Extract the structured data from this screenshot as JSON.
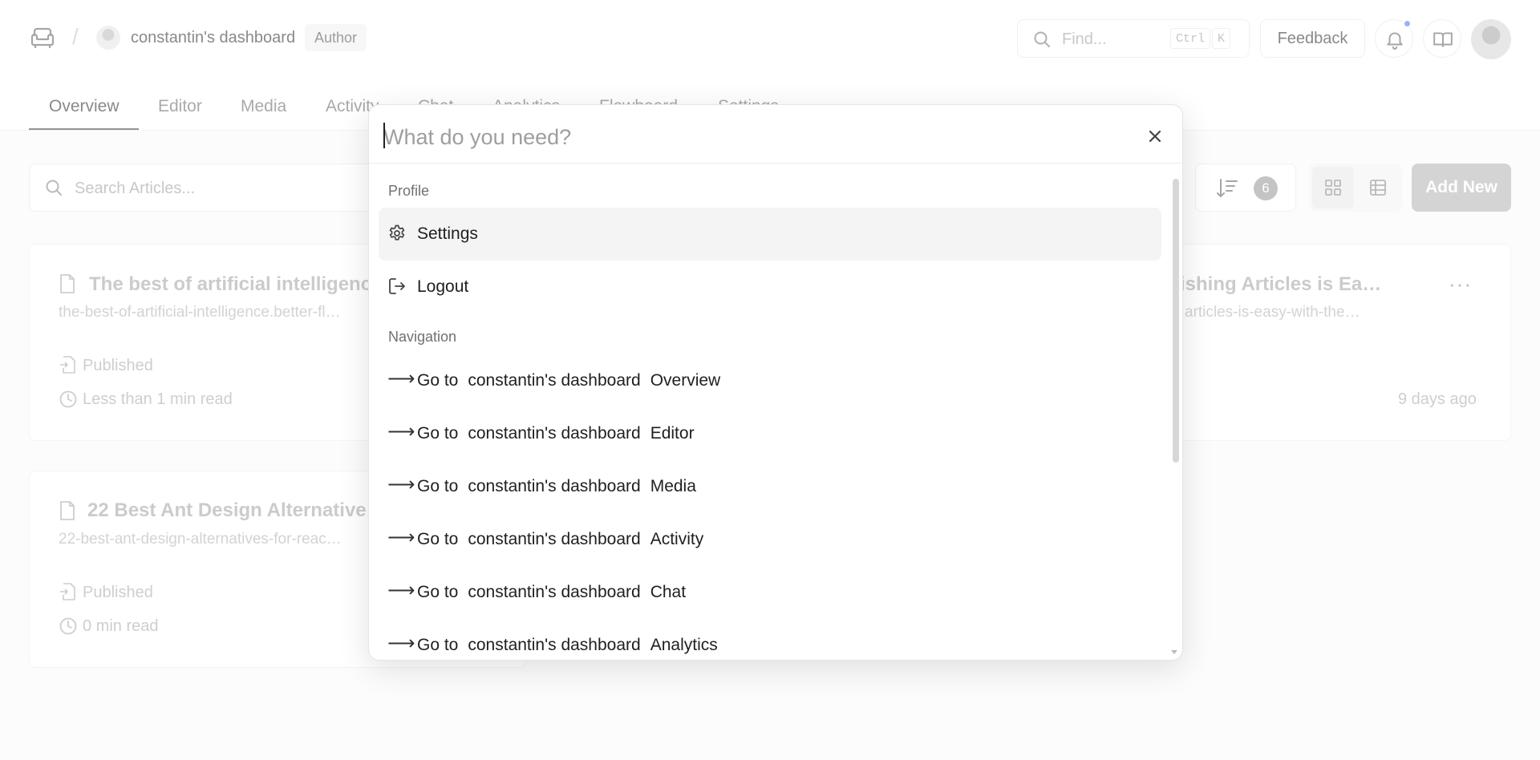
{
  "header": {
    "workspace_name": "constantin's dashboard",
    "role_badge": "Author",
    "find_placeholder": "Find...",
    "shortcut_ctrl": "Ctrl",
    "shortcut_key": "K",
    "feedback_label": "Feedback",
    "has_notification": true,
    "notification_color": "#4f7df2"
  },
  "tabs": [
    {
      "label": "Overview",
      "active": true
    },
    {
      "label": "Editor"
    },
    {
      "label": "Media"
    },
    {
      "label": "Activity"
    },
    {
      "label": "Chat"
    },
    {
      "label": "Analytics"
    },
    {
      "label": "Flowboard"
    },
    {
      "label": "Settings"
    }
  ],
  "toolbar": {
    "search_placeholder": "Search Articles...",
    "sort_count": "6",
    "add_new_label": "Add New"
  },
  "articles": [
    {
      "title": "The best of artificial intelligenc",
      "slug": "the-best-of-artificial-intelligence.better-fl…",
      "status": "Published",
      "read_time": "Less than 1 min read"
    },
    {
      "title": "22 Best Ant Design Alternative",
      "slug": "22-best-ant-design-alternatives-for-reac…",
      "status": "Published",
      "read_time": "0 min read"
    },
    {
      "title": "ishing Articles is Ea…",
      "slug": "articles-is-easy-with-the…",
      "age": "9 days ago",
      "more": "···"
    }
  ],
  "palette": {
    "placeholder": "What do you need?",
    "sections": [
      {
        "label": "Profile",
        "items": [
          {
            "label": "Settings",
            "icon": "gear-icon",
            "selected": true
          },
          {
            "label": "Logout",
            "icon": "logout-icon"
          }
        ]
      },
      {
        "label": "Navigation",
        "items": [
          {
            "prefix": "Go to",
            "workspace": "constantin's dashboard",
            "target": "Overview"
          },
          {
            "prefix": "Go to",
            "workspace": "constantin's dashboard",
            "target": "Editor"
          },
          {
            "prefix": "Go to",
            "workspace": "constantin's dashboard",
            "target": "Media"
          },
          {
            "prefix": "Go to",
            "workspace": "constantin's dashboard",
            "target": "Activity"
          },
          {
            "prefix": "Go to",
            "workspace": "constantin's dashboard",
            "target": "Chat"
          },
          {
            "prefix": "Go to",
            "workspace": "constantin's dashboard",
            "target": "Analytics"
          }
        ]
      }
    ],
    "arrow_glyph": "⟶"
  }
}
